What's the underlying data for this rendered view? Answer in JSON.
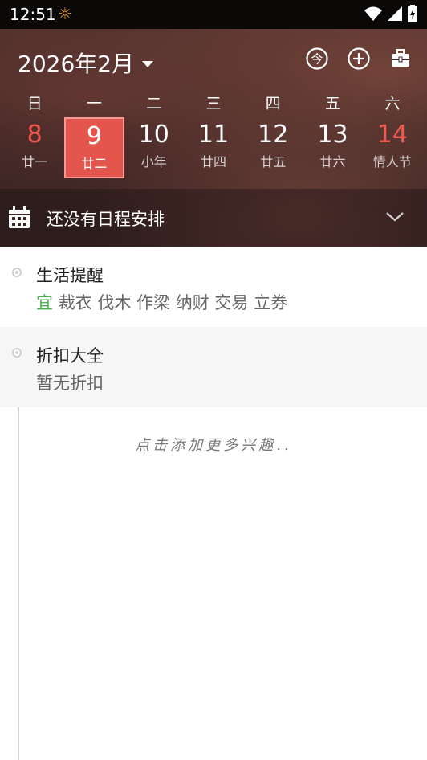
{
  "status_bar": {
    "time": "12:51"
  },
  "header": {
    "month_title": "2026年2月",
    "weekdays": [
      "日",
      "一",
      "二",
      "三",
      "四",
      "五",
      "六"
    ],
    "dates": [
      {
        "num": "8",
        "lunar": "廿一"
      },
      {
        "num": "9",
        "lunar": "廿二"
      },
      {
        "num": "10",
        "lunar": "小年"
      },
      {
        "num": "11",
        "lunar": "廿四"
      },
      {
        "num": "12",
        "lunar": "廿五"
      },
      {
        "num": "13",
        "lunar": "廿六"
      },
      {
        "num": "14",
        "lunar": "情人节"
      }
    ],
    "today_icon_label": "今"
  },
  "schedule": {
    "text": "还没有日程安排"
  },
  "life_tips": {
    "title": "生活提醒",
    "yi": "宜",
    "items": "裁衣 伐木 作梁 纳财 交易 立券"
  },
  "discounts": {
    "title": "折扣大全",
    "sub": "暂无折扣"
  },
  "add_more": "点击添加更多兴趣..",
  "colors": {
    "accent": "#e3554d",
    "weekend": "#f0584f",
    "yi": "#4caf50"
  }
}
